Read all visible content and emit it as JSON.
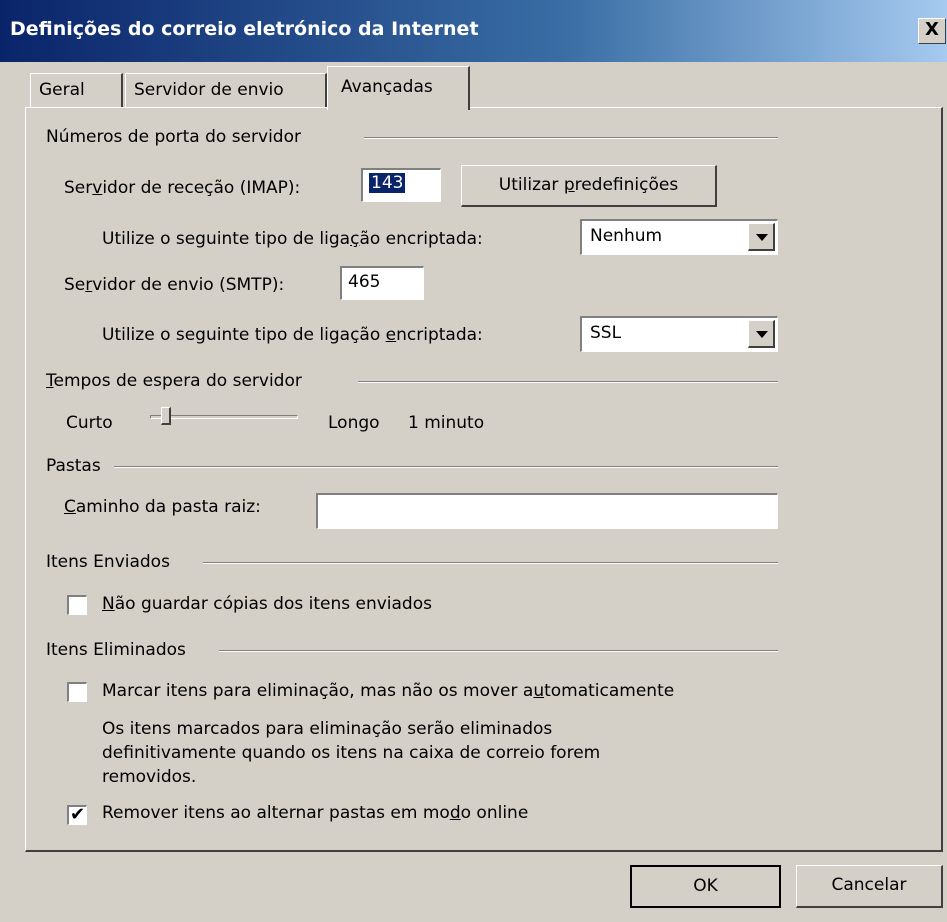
{
  "window": {
    "title": "Definições do correio eletrónico da Internet",
    "close_label": "X"
  },
  "tabs": [
    {
      "label": "Geral"
    },
    {
      "label": "Servidor de envio"
    },
    {
      "label": "Avançadas",
      "selected": true
    }
  ],
  "ports": {
    "section_title": "Números de porta do servidor",
    "imap_label_pre": "Ser",
    "imap_label_key": "v",
    "imap_label_post": "idor de receção (IMAP):",
    "imap_value": "143",
    "defaults_button_pre": "Utilizar ",
    "defaults_button_key": "p",
    "defaults_button_post": "redefinições",
    "imap_encryption_label_pre": "Utilize o seguinte tipo de liga",
    "imap_encryption_label_key": "ç",
    "imap_encryption_label_post": "ão encriptada:",
    "imap_encryption_value": "Nenhum",
    "smtp_label_pre": "Se",
    "smtp_label_key": "r",
    "smtp_label_post": "vidor de envio (SMTP):",
    "smtp_value": "465",
    "smtp_encryption_label_pre": "Utilize o seguinte tipo de ligação ",
    "smtp_encryption_label_key": "e",
    "smtp_encryption_label_post": "ncriptada:",
    "smtp_encryption_value": "SSL"
  },
  "timeouts": {
    "section_title_key": "T",
    "section_title_rest": "empos de espera do servidor",
    "short_label": "Curto",
    "long_label": "Longo",
    "value_text": "1 minuto",
    "level_fraction": 0.08
  },
  "folders": {
    "section_title": "Pastas",
    "root_path_label_key": "C",
    "root_path_label_rest": "aminho da pasta raiz:",
    "root_path_value": ""
  },
  "sent_items": {
    "section_title": "Itens Enviados",
    "no_copies_label_key": "N",
    "no_copies_label_rest": "ão guardar cópias dos itens enviados",
    "no_copies_checked": false
  },
  "deleted_items": {
    "section_title": "Itens Eliminados",
    "mark_label_pre": "Marcar itens para eliminação, mas não os mover a",
    "mark_label_key": "u",
    "mark_label_post": "tomaticamente",
    "mark_checked": false,
    "description_line1": "Os itens marcados para eliminação serão eliminados",
    "description_line2": "definitivamente quando os itens na caixa de correio forem",
    "description_line3": "removidos.",
    "purge_label_pre": "Remover itens ao alternar pastas em mo",
    "purge_label_key": "d",
    "purge_label_post": "o online",
    "purge_checked": true,
    "check_mark": "✔"
  },
  "footer": {
    "ok_label": "OK",
    "cancel_label": "Cancelar"
  }
}
